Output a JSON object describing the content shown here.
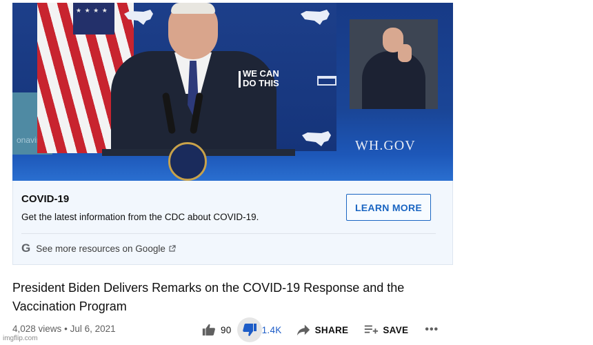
{
  "video": {
    "banner_text_line1": "WE CAN",
    "banner_text_line2": "DO THIS",
    "site_watermark": "WH.GOV",
    "side_text": "onavir"
  },
  "info_panel": {
    "title": "COVID-19",
    "description": "Get the latest information from the CDC about COVID-19.",
    "cta_label": "LEARN MORE",
    "resources_link": "See more resources on Google",
    "g_glyph": "G"
  },
  "video_title": "President Biden Delivers Remarks on the COVID-19 Response and the Vaccination Program",
  "meta": {
    "views": "4,028 views",
    "separator": "•",
    "date": "Jul 6, 2021"
  },
  "actions": {
    "like_count": "90",
    "dislike_count": "1.4K",
    "share_label": "SHARE",
    "save_label": "SAVE",
    "more_label": "•••"
  },
  "watermark": "imgflip.com",
  "colors": {
    "accent_blue": "#1a65c2",
    "panel_bg": "#f2f7fd",
    "video_blue": "#173a86"
  }
}
